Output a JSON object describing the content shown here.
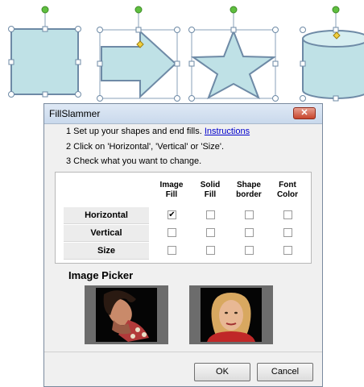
{
  "dialog": {
    "title": "FillSlammer",
    "close_glyph": "✕",
    "instructions": {
      "line1_prefix": "1 Set up your shapes and end fills.",
      "line1_link": "Instructions",
      "line2": "2 Click on 'Horizontal', 'Vertical' or 'Size'.",
      "line3": "3 Check what you want to change."
    },
    "columns": [
      {
        "line1": "Image",
        "line2": "Fill"
      },
      {
        "line1": "Solid",
        "line2": "Fill"
      },
      {
        "line1": "Shape",
        "line2": "border"
      },
      {
        "line1": "Font",
        "line2": "Color"
      }
    ],
    "rows": [
      {
        "label": "Horizontal",
        "checked": [
          true,
          false,
          false,
          false
        ]
      },
      {
        "label": "Vertical",
        "checked": [
          false,
          false,
          false,
          false
        ]
      },
      {
        "label": "Size",
        "checked": [
          false,
          false,
          false,
          false
        ]
      }
    ],
    "image_picker_label": "Image Picker",
    "ok_label": "OK",
    "cancel_label": "Cancel"
  },
  "colors": {
    "shape_fill": "#bfe1e6",
    "shape_stroke": "#6e8aa6",
    "handle_green": "#5fbf3f",
    "link": "#0000cc"
  },
  "icons": [
    "close-icon",
    "checkmark-icon",
    "rotation-handle-icon",
    "resize-handle-icon"
  ]
}
